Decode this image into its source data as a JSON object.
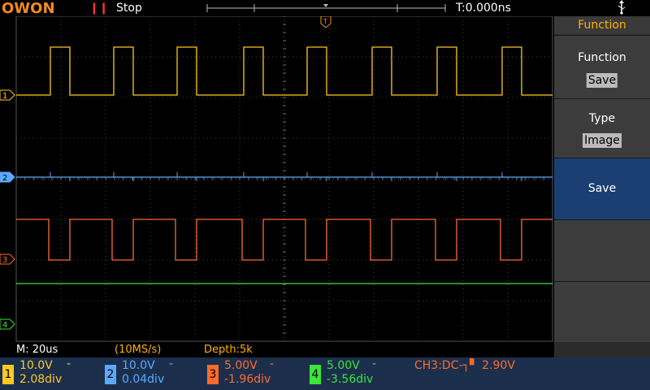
{
  "header": {
    "brand": "OWON",
    "run_state": "Stop",
    "trigger_time": "T:0.000ns"
  },
  "markers": {
    "ch1": "1",
    "ch2": "2",
    "ch3": "3",
    "ch4": "4",
    "trigger": "T"
  },
  "info": {
    "timebase": "M: 20us",
    "sample_rate": "(10MS/s)",
    "depth": "Depth:5k"
  },
  "menu": {
    "title": "Function",
    "items": [
      {
        "label": "Function",
        "value": "Save"
      },
      {
        "label": "Type",
        "value": "Image"
      },
      {
        "label": "Save",
        "value": ""
      }
    ]
  },
  "channels": [
    {
      "num": "1",
      "volts": "10.0V",
      "coupling": "-",
      "offset": "2.08div",
      "color": "#ffc81e"
    },
    {
      "num": "2",
      "volts": "10.0V",
      "coupling": "-",
      "offset": "0.04div",
      "color": "#5aa9ff"
    },
    {
      "num": "3",
      "volts": "5.00V",
      "coupling": "-",
      "offset": "-1.96div",
      "color": "#ff6a2b"
    },
    {
      "num": "4",
      "volts": "5.00V",
      "coupling": "-",
      "offset": "-3.56div",
      "color": "#39e639"
    }
  ],
  "trigger_info": "CH3:DC-┐▘ 2.90V",
  "colors": {
    "ch1": "#ffc81e",
    "ch2": "#5aa9ff",
    "ch3": "#ff6a2b",
    "ch4": "#39e639",
    "accent": "#ffb100"
  }
}
